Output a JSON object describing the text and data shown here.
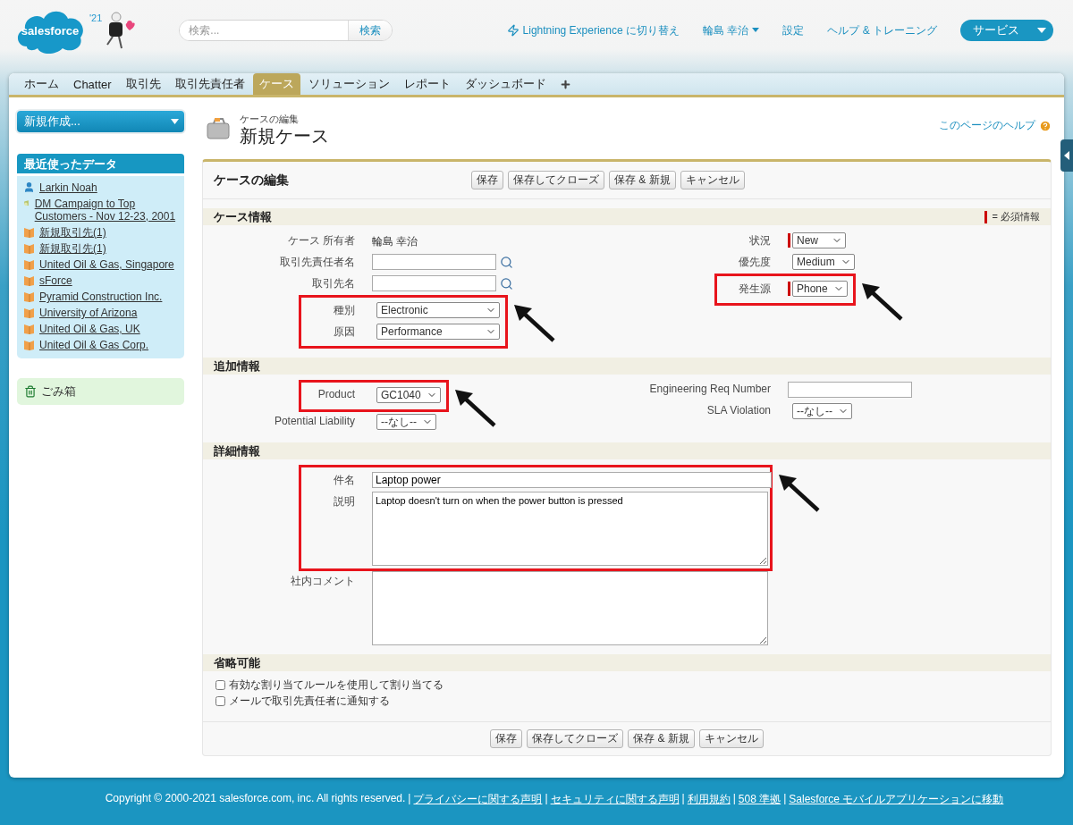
{
  "header": {
    "logo": "salesforce",
    "badge": "'21",
    "search": {
      "placeholder": "検索...",
      "button": "検索"
    },
    "lightning_link": "Lightning Experience に切り替え",
    "user_menu": "輪島 幸治",
    "setup_link": "設定",
    "help_link": "ヘルプ & トレーニング",
    "app_menu": "サービス"
  },
  "tabs": [
    {
      "label": "ホーム",
      "selected": false
    },
    {
      "label": "Chatter",
      "selected": false
    },
    {
      "label": "取引先",
      "selected": false
    },
    {
      "label": "取引先責任者",
      "selected": false
    },
    {
      "label": "ケース",
      "selected": true
    },
    {
      "label": "ソリューション",
      "selected": false
    },
    {
      "label": "レポート",
      "selected": false
    },
    {
      "label": "ダッシュボード",
      "selected": false
    }
  ],
  "sidebar": {
    "create_new": "新規作成...",
    "recent_title": "最近使ったデータ",
    "recent_items": [
      {
        "kind": "contact",
        "label": "Larkin Noah"
      },
      {
        "kind": "campaign",
        "label": "DM Campaign to Top Customers - Nov 12-23, 2001"
      },
      {
        "kind": "account",
        "label": "新規取引先(1)"
      },
      {
        "kind": "account",
        "label": "新規取引先(1)"
      },
      {
        "kind": "account",
        "label": "United Oil & Gas, Singapore"
      },
      {
        "kind": "account",
        "label": "sForce"
      },
      {
        "kind": "account",
        "label": "Pyramid Construction Inc."
      },
      {
        "kind": "account",
        "label": "University of Arizona"
      },
      {
        "kind": "account",
        "label": "United Oil & Gas, UK"
      },
      {
        "kind": "account",
        "label": "United Oil & Gas Corp."
      }
    ],
    "recycle_bin": "ごみ箱"
  },
  "page_header": {
    "subtitle": "ケースの編集",
    "title": "新規ケース",
    "help_link": "このページのヘルプ"
  },
  "form": {
    "title": "ケースの編集",
    "top_buttons": [
      "保存",
      "保存してクローズ",
      "保存 & 新規",
      "キャンセル"
    ],
    "required_legend": "= 必須情報",
    "sections": [
      {
        "title": "ケース情報",
        "left": [
          {
            "label": "ケース 所有者",
            "kind": "text",
            "value": "輪島 幸治"
          },
          {
            "label": "取引先責任者名",
            "kind": "lookup"
          },
          {
            "label": "取引先名",
            "kind": "lookup"
          },
          {
            "label": "種別",
            "kind": "select",
            "value": "Electronic",
            "highlighted": true
          },
          {
            "label": "原因",
            "kind": "select",
            "value": "Performance",
            "highlighted": true
          }
        ],
        "right": [
          {
            "label": "状況",
            "kind": "select",
            "value": "New",
            "required": true
          },
          {
            "label": "優先度",
            "kind": "select",
            "value": "Medium"
          },
          {
            "label": "発生源",
            "kind": "select",
            "value": "Phone",
            "required": true,
            "highlighted": true
          }
        ]
      },
      {
        "title": "追加情報",
        "left": [
          {
            "label": "Product",
            "kind": "select",
            "value": "GC1040",
            "highlighted": true
          },
          {
            "label": "Potential Liability",
            "kind": "select",
            "value": "--なし--"
          }
        ],
        "right": [
          {
            "label": "Engineering Req Number",
            "kind": "input"
          },
          {
            "label": "SLA Violation",
            "kind": "select",
            "value": "--なし--"
          }
        ]
      },
      {
        "title": "詳細情報",
        "left": [
          {
            "label": "件名",
            "kind": "wide_input",
            "value": "Laptop power",
            "highlighted": true
          },
          {
            "label": "説明",
            "kind": "textarea",
            "value": "Laptop doesn't turn on when the power button is pressed",
            "highlighted": true
          },
          {
            "label": "社内コメント",
            "kind": "textarea"
          }
        ]
      },
      {
        "title": "省略可能",
        "options": [
          {
            "label": "有効な割り当てルールを使用して割り当てる",
            "checked": false
          },
          {
            "label": "メールで取引先責任者に通知する",
            "checked": false
          }
        ]
      }
    ],
    "bottom_buttons": [
      "保存",
      "保存してクローズ",
      "保存 & 新規",
      "キャンセル"
    ]
  },
  "footer": {
    "copyright": "Copyright © 2000-2021 salesforce.com, inc. All rights reserved.",
    "separator": "|",
    "links": [
      "プライバシーに関する声明",
      "セキュリティに関する声明",
      "利用規約",
      "508 準拠",
      "Salesforce モバイルアプリケーションに移動"
    ]
  }
}
